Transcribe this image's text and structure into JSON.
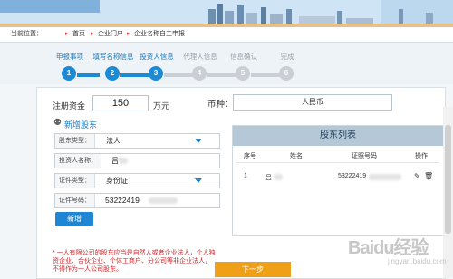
{
  "breadcrumb": {
    "prefix": "当前位置：",
    "items": [
      "首页",
      "企业门户",
      "企业名称自主申报"
    ]
  },
  "steps": [
    {
      "label": "申报事项",
      "num": "1",
      "done": true
    },
    {
      "label": "填写名称信息",
      "num": "2",
      "done": true
    },
    {
      "label": "投资人信息",
      "num": "3",
      "done": true
    },
    {
      "label": "代理人信息",
      "num": "4",
      "done": false
    },
    {
      "label": "信息确认",
      "num": "5",
      "done": false
    },
    {
      "label": "完成",
      "num": "6",
      "done": false
    }
  ],
  "capital": {
    "label": "注册资金",
    "value": "150",
    "unit": "万元"
  },
  "currency": {
    "label": "币种：",
    "value": "人民币"
  },
  "add_shareholder": {
    "title": "新增股东",
    "type_label": "股东类型：",
    "type_value": "法人",
    "name_label": "投资人名称：",
    "name_value": "吕",
    "id_type_label": "证件类型：",
    "id_type_value": "身份证",
    "id_no_label": "证件号码：",
    "id_no_value": "53222419",
    "add_button": "新增"
  },
  "list": {
    "title": "股东列表",
    "columns": [
      "序号",
      "姓名",
      "证照号码",
      "操作"
    ],
    "rows": [
      {
        "seq": "1",
        "name": "吕",
        "id": "53222419"
      }
    ]
  },
  "note": "* 一人有限公司的股东应当是自然人或者企业法人，个人独资企业、合伙企业、个体工商户、分公司等非企业法人，不得作为一人公司股东。",
  "next_button": "下一步",
  "watermark": {
    "main": "Baidu经验",
    "sub": "jingyan.baidu.com"
  }
}
